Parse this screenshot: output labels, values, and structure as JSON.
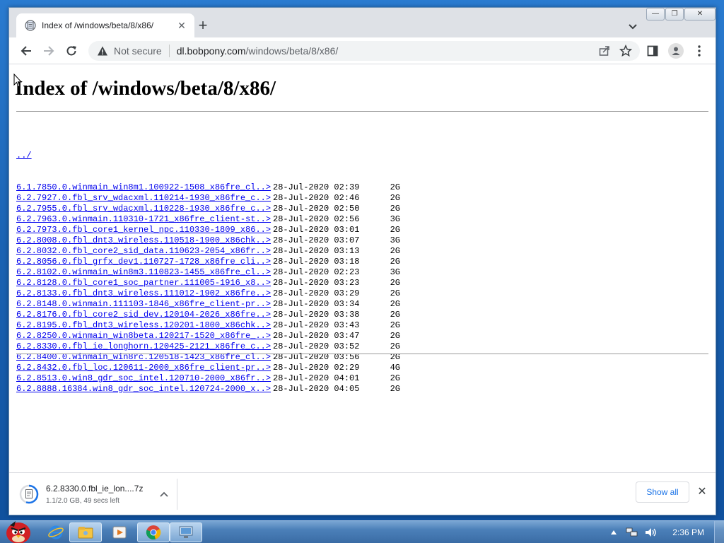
{
  "browser": {
    "tab": {
      "title": "Index of /windows/beta/8/x86/",
      "close_glyph": "✕",
      "favicon": "globe-icon"
    },
    "new_tab_glyph": "+",
    "window_controls": {
      "minimize": "—",
      "restore": "❐",
      "close": "✕"
    },
    "omnibox": {
      "security_label": "Not secure",
      "url_host": "dl.bobpony.com",
      "url_path": "/windows/beta/8/x86/"
    }
  },
  "page": {
    "title": "Index of /windows/beta/8/x86/",
    "parent_link": "../",
    "files": [
      {
        "name": "6.1.7850.0.winmain_win8m1.100922-1508_x86fre_cl..>",
        "date": "28-Jul-2020 02:39",
        "size": "2G"
      },
      {
        "name": "6.2.7927.0.fbl_srv_wdacxml.110214-1930_x86fre_c..>",
        "date": "28-Jul-2020 02:46",
        "size": "2G"
      },
      {
        "name": "6.2.7955.0.fbl_srv_wdacxml.110228-1930_x86fre_c..>",
        "date": "28-Jul-2020 02:50",
        "size": "2G"
      },
      {
        "name": "6.2.7963.0.winmain.110310-1721_x86fre_client-st..>",
        "date": "28-Jul-2020 02:56",
        "size": "3G"
      },
      {
        "name": "6.2.7973.0.fbl_core1_kernel_npc.110330-1809_x86..>",
        "date": "28-Jul-2020 03:01",
        "size": "2G"
      },
      {
        "name": "6.2.8008.0.fbl_dnt3_wireless.110518-1900_x86chk..>",
        "date": "28-Jul-2020 03:07",
        "size": "3G"
      },
      {
        "name": "6.2.8032.0.fbl_core2_sid_data.110623-2054_x86fr..>",
        "date": "28-Jul-2020 03:13",
        "size": "2G"
      },
      {
        "name": "6.2.8056.0.fbl_grfx_dev1.110727-1728_x86fre_cli..>",
        "date": "28-Jul-2020 03:18",
        "size": "2G"
      },
      {
        "name": "6.2.8102.0.winmain_win8m3.110823-1455_x86fre_cl..>",
        "date": "28-Jul-2020 02:23",
        "size": "3G"
      },
      {
        "name": "6.2.8128.0.fbl_core1_soc_partner.111005-1916_x8..>",
        "date": "28-Jul-2020 03:23",
        "size": "2G"
      },
      {
        "name": "6.2.8133.0.fbl_dnt3_wireless.111012-1902_x86fre..>",
        "date": "28-Jul-2020 03:29",
        "size": "2G"
      },
      {
        "name": "6.2.8148.0.winmain.111103-1846_x86fre_client-pr..>",
        "date": "28-Jul-2020 03:34",
        "size": "2G"
      },
      {
        "name": "6.2.8176.0.fbl_core2_sid_dev.120104-2026_x86fre..>",
        "date": "28-Jul-2020 03:38",
        "size": "2G"
      },
      {
        "name": "6.2.8195.0.fbl_dnt3_wireless.120201-1800_x86chk..>",
        "date": "28-Jul-2020 03:43",
        "size": "2G"
      },
      {
        "name": "6.2.8250.0.winmain_win8beta.120217-1520_x86fre_..>",
        "date": "28-Jul-2020 03:47",
        "size": "2G"
      },
      {
        "name": "6.2.8330.0.fbl_ie_longhorn.120425-2121_x86fre_c..>",
        "date": "28-Jul-2020 03:52",
        "size": "2G"
      },
      {
        "name": "6.2.8400.0.winmain_win8rc.120518-1423_x86fre_cl..>",
        "date": "28-Jul-2020 03:56",
        "size": "2G"
      },
      {
        "name": "6.2.8432.0.fbl_loc.120611-2000_x86fre_client-pr..>",
        "date": "28-Jul-2020 02:29",
        "size": "4G"
      },
      {
        "name": "6.2.8513.0.win8_gdr_soc_intel.120710-2000_x86fr..>",
        "date": "28-Jul-2020 04:01",
        "size": "2G"
      },
      {
        "name": "6.2.8888.16384.win8_gdr_soc_intel.120724-2000_x..>",
        "date": "28-Jul-2020 04:05",
        "size": "2G"
      }
    ]
  },
  "download_shelf": {
    "item": {
      "name": "6.2.8330.0.fbl_ie_lon....7z",
      "status": "1.1/2.0 GB, 49 secs left",
      "progress": 0.55
    },
    "show_all_label": "Show all",
    "close_glyph": "✕"
  },
  "taskbar": {
    "clock": "2:36 PM",
    "pinned": [
      "internet-explorer-icon",
      "file-explorer-icon",
      "media-player-icon",
      "chrome-icon",
      "network-app-icon"
    ],
    "active_index": 3
  },
  "colors": {
    "link": "#0000ee",
    "accent": "#1a73e8",
    "taskbar": "#4b7fb8"
  }
}
